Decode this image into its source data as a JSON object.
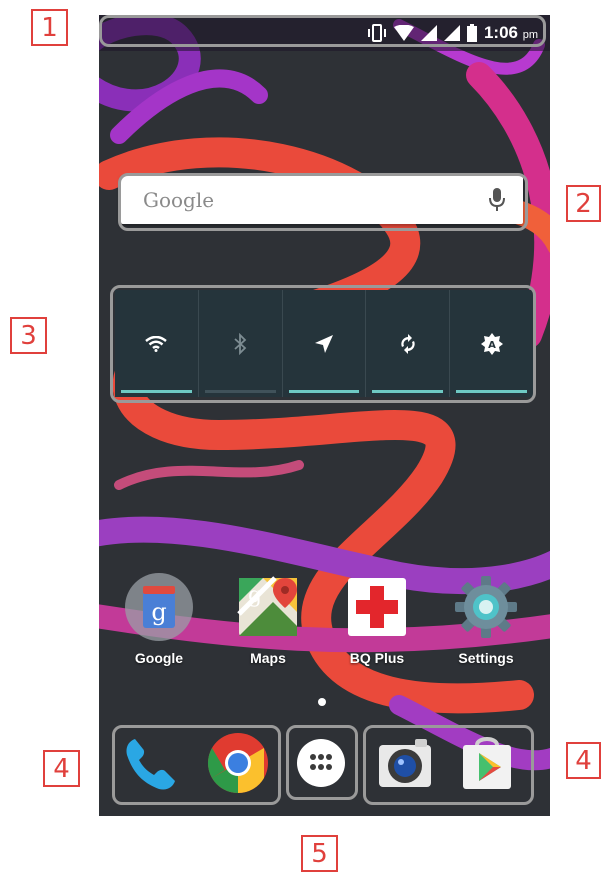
{
  "callouts": [
    "1",
    "2",
    "3",
    "4",
    "4",
    "5"
  ],
  "status": {
    "time": "1:06",
    "ampm": "pm",
    "icons": [
      "vibrate-icon",
      "wifi-icon",
      "signal-icon",
      "signal-icon",
      "battery-icon"
    ]
  },
  "search": {
    "brand": "Google",
    "icon": "mic-icon"
  },
  "toggles": [
    {
      "name": "wifi",
      "icon": "wifi-icon",
      "on": true
    },
    {
      "name": "bluetooth",
      "icon": "bluetooth-icon",
      "on": false
    },
    {
      "name": "location",
      "icon": "location-icon",
      "on": true
    },
    {
      "name": "sync",
      "icon": "sync-icon",
      "on": true
    },
    {
      "name": "brightness",
      "icon": "auto-brightness-icon",
      "on": true
    }
  ],
  "apps": [
    {
      "label": "Google",
      "icon": "google-folder-icon"
    },
    {
      "label": "Maps",
      "icon": "maps-icon"
    },
    {
      "label": "BQ Plus",
      "icon": "bq-plus-icon"
    },
    {
      "label": "Settings",
      "icon": "settings-icon"
    }
  ],
  "dock": [
    "phone-icon",
    "chrome-icon",
    "app-drawer-icon",
    "camera-icon",
    "play-store-icon"
  ],
  "colors": {
    "callout": "#e0403c",
    "highlight": "#9a9a9a",
    "toggle_on": "#6ec9c3",
    "widget_bg": "#25343b"
  }
}
